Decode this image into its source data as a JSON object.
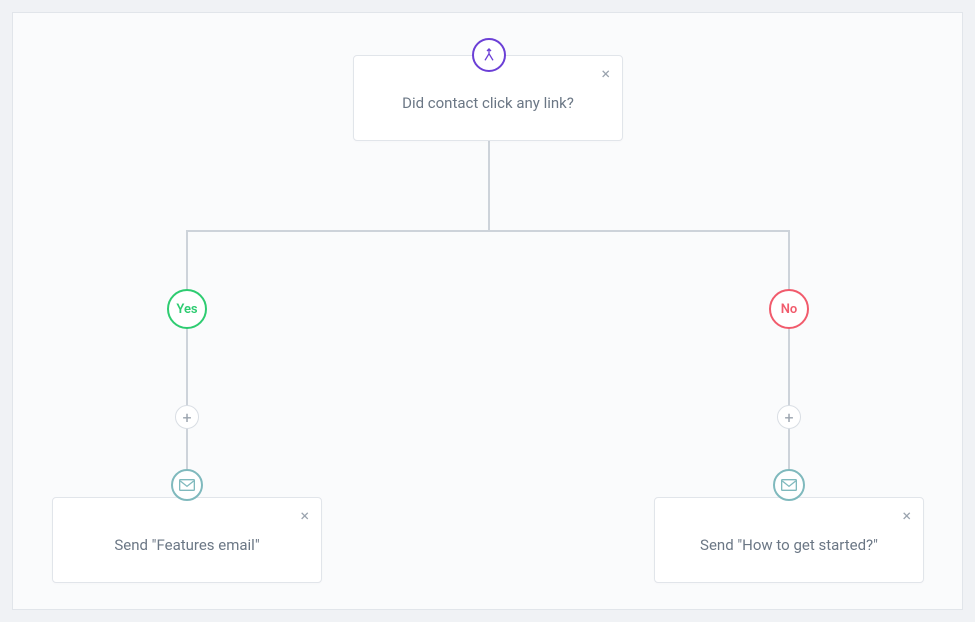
{
  "decision": {
    "label": "Did contact click any link?",
    "icon": "split-icon",
    "yes_label": "Yes",
    "no_label": "No"
  },
  "yes_action": {
    "label": "Send \"Features email\"",
    "icon": "email-icon"
  },
  "no_action": {
    "label": "Send \"How to get started?\"",
    "icon": "email-icon"
  },
  "colors": {
    "accent": "#6b3fd6",
    "yes": "#2ecc71",
    "no": "#f15b6c",
    "email_icon": "#7fb9bd",
    "text": "#6b7785",
    "border": "#e1e5ea",
    "canvas_bg": "#fafbfc",
    "page_bg": "#f0f2f5"
  }
}
